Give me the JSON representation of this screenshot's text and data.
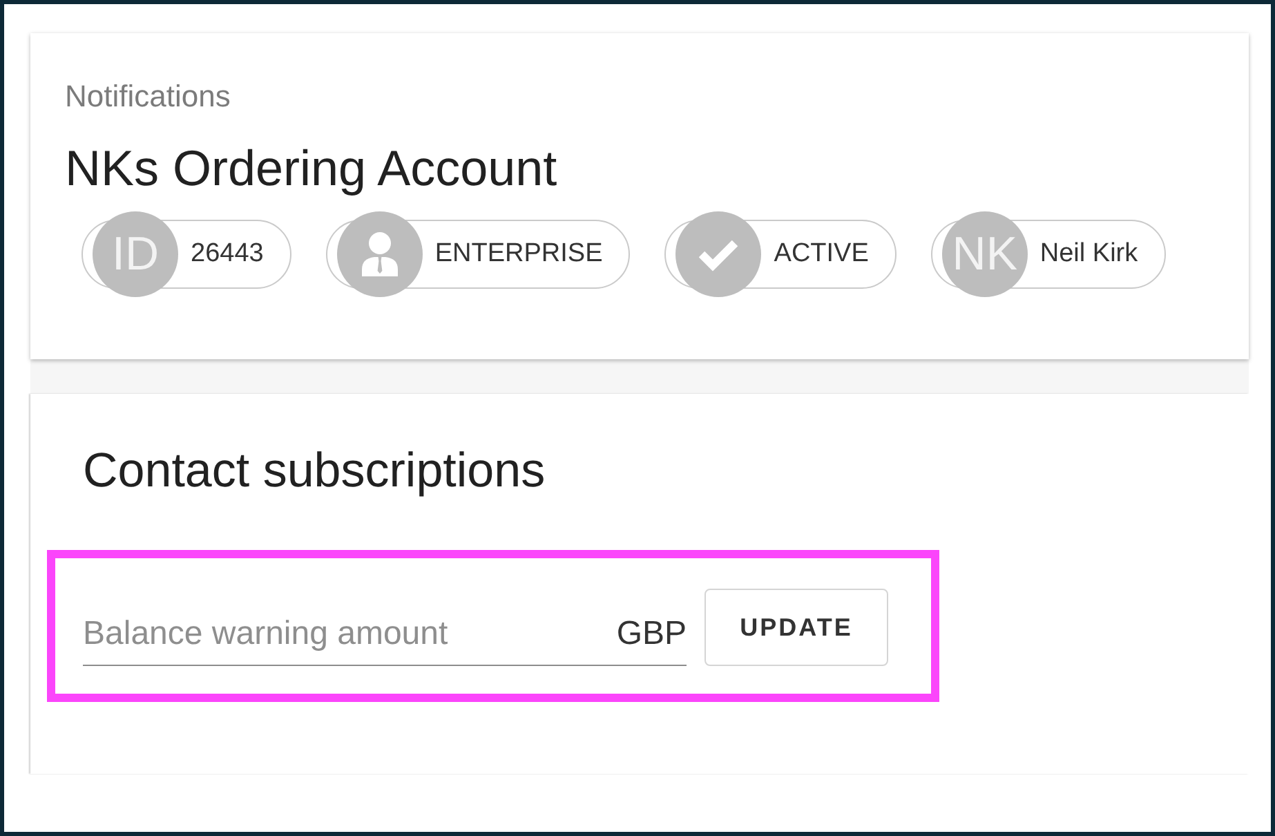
{
  "account": {
    "section_label": "Notifications",
    "title": "NKs Ordering Account"
  },
  "chips": [
    {
      "kind": "initials",
      "avatar": "ID",
      "label": "26443"
    },
    {
      "kind": "person",
      "label": "ENTERPRISE"
    },
    {
      "kind": "check",
      "label": "ACTIVE"
    },
    {
      "kind": "initials",
      "avatar": "NK",
      "label": "Neil Kirk"
    }
  ],
  "subscriptions": {
    "title": "Contact subscriptions",
    "highlighted": true,
    "field": {
      "placeholder": "Balance warning amount",
      "suffix": "GBP"
    },
    "button": "UPDATE"
  }
}
